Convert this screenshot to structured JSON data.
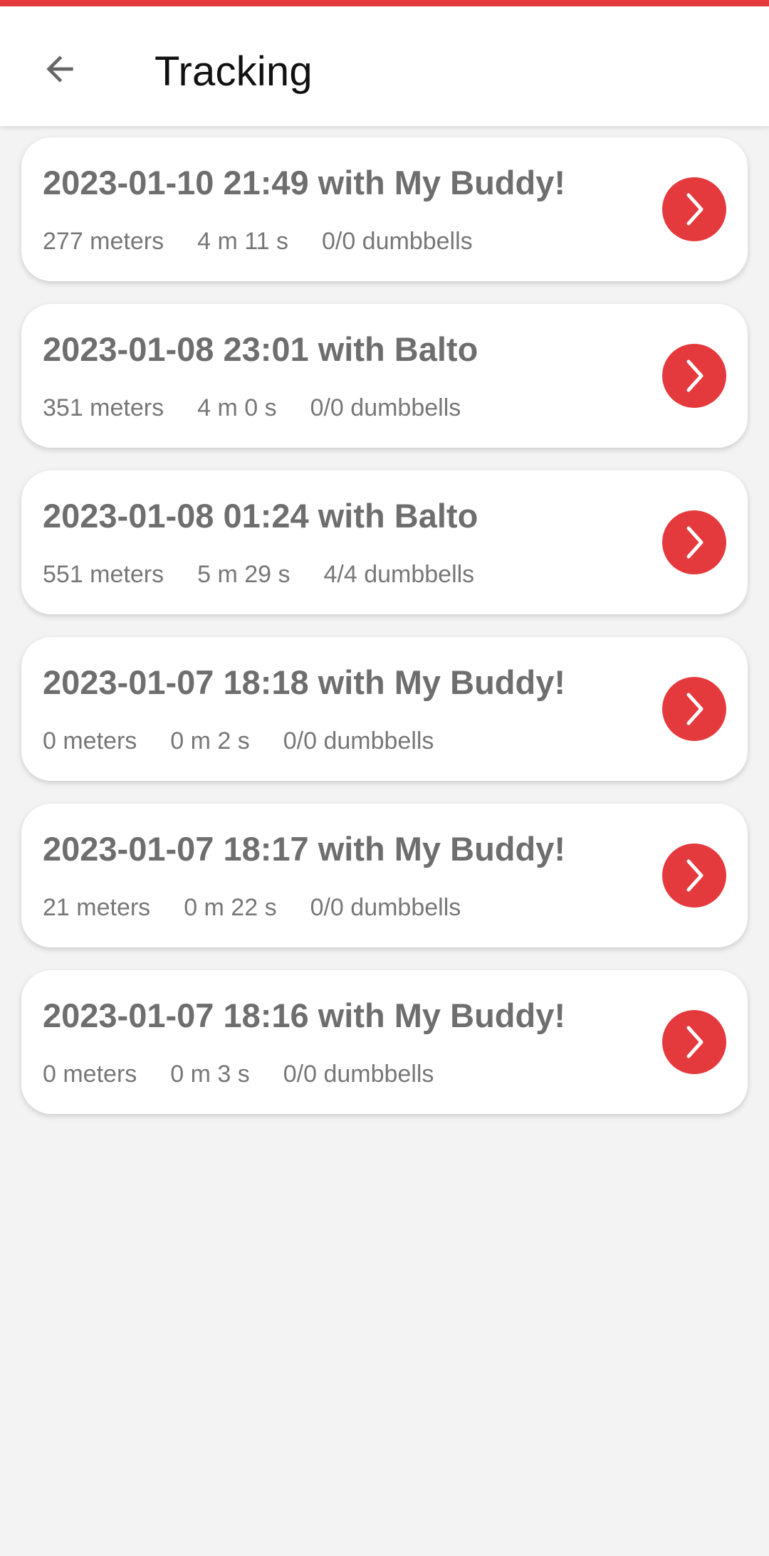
{
  "colors": {
    "accent": "#e53a3d",
    "background": "#f3f3f3",
    "card": "#ffffff",
    "title_text": "#111111",
    "card_title_text": "#6e6e6e",
    "card_stats_text": "#777777"
  },
  "app_bar": {
    "title": "Tracking",
    "back_icon": "arrow-left-icon"
  },
  "sessions": [
    {
      "title": "2023-01-10 21:49 with My Buddy!",
      "distance": "277 meters",
      "duration": "4 m 11 s",
      "dumbbells": "0/0 dumbbells",
      "action_icon": "chevron-right-icon"
    },
    {
      "title": "2023-01-08 23:01 with Balto",
      "distance": "351 meters",
      "duration": "4 m 0 s",
      "dumbbells": "0/0 dumbbells",
      "action_icon": "chevron-right-icon"
    },
    {
      "title": "2023-01-08 01:24 with Balto",
      "distance": "551 meters",
      "duration": "5 m 29 s",
      "dumbbells": "4/4 dumbbells",
      "action_icon": "chevron-right-icon"
    },
    {
      "title": "2023-01-07 18:18 with My Buddy!",
      "distance": "0 meters",
      "duration": "0 m 2 s",
      "dumbbells": "0/0 dumbbells",
      "action_icon": "chevron-right-icon"
    },
    {
      "title": "2023-01-07 18:17 with My Buddy!",
      "distance": "21 meters",
      "duration": "0 m 22 s",
      "dumbbells": "0/0 dumbbells",
      "action_icon": "chevron-right-icon"
    },
    {
      "title": "2023-01-07 18:16 with My Buddy!",
      "distance": "0 meters",
      "duration": "0 m 3 s",
      "dumbbells": "0/0 dumbbells",
      "action_icon": "chevron-right-icon"
    }
  ]
}
